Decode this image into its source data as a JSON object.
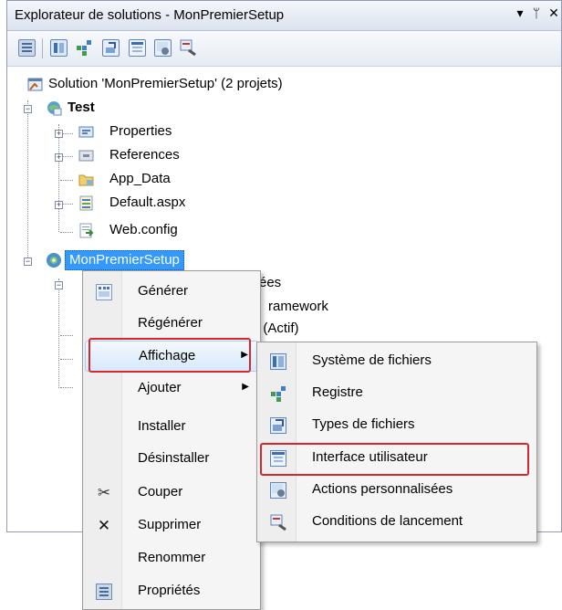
{
  "window": {
    "title": "Explorateur de solutions - MonPremierSetup",
    "dropdown_glyph": "▾",
    "pin_glyph": "ᛘ",
    "close_glyph": "✕"
  },
  "tree": {
    "solution": "Solution 'MonPremierSetup' (2 projets)",
    "project_test": "Test",
    "properties": "Properties",
    "references": "References",
    "app_data": "App_Data",
    "default_aspx": "Default.aspx",
    "web_config": "Web.config",
    "setup_project": "MonPremierSetup",
    "partial_1": "ées",
    "partial_2": "ramework",
    "partial_3": "t (Actif)"
  },
  "context_menu": {
    "items": [
      {
        "label": "Générer",
        "icon": "build-icon"
      },
      {
        "label": "Régénérer",
        "icon": ""
      },
      {
        "label": "Affichage",
        "icon": "",
        "submenu": true
      },
      {
        "label": "Ajouter",
        "icon": "",
        "submenu": true
      },
      {
        "label": "Installer",
        "icon": ""
      },
      {
        "label": "Désinstaller",
        "icon": ""
      },
      {
        "label": "Couper",
        "icon": "scissors-icon"
      },
      {
        "label": "Supprimer",
        "icon": "delete-icon"
      },
      {
        "label": "Renommer",
        "icon": ""
      },
      {
        "label": "Propriétés",
        "icon": "properties-icon"
      }
    ],
    "arrow": "▶"
  },
  "submenu": {
    "items": [
      {
        "label": "Système de fichiers"
      },
      {
        "label": "Registre"
      },
      {
        "label": "Types de fichiers"
      },
      {
        "label": "Interface utilisateur"
      },
      {
        "label": "Actions personnalisées"
      },
      {
        "label": "Conditions de lancement"
      }
    ]
  },
  "glyphs": {
    "scissors": "✂",
    "delete": "✕"
  },
  "colors": {
    "highlight": "#d6262f",
    "selection": "#3399ff"
  }
}
